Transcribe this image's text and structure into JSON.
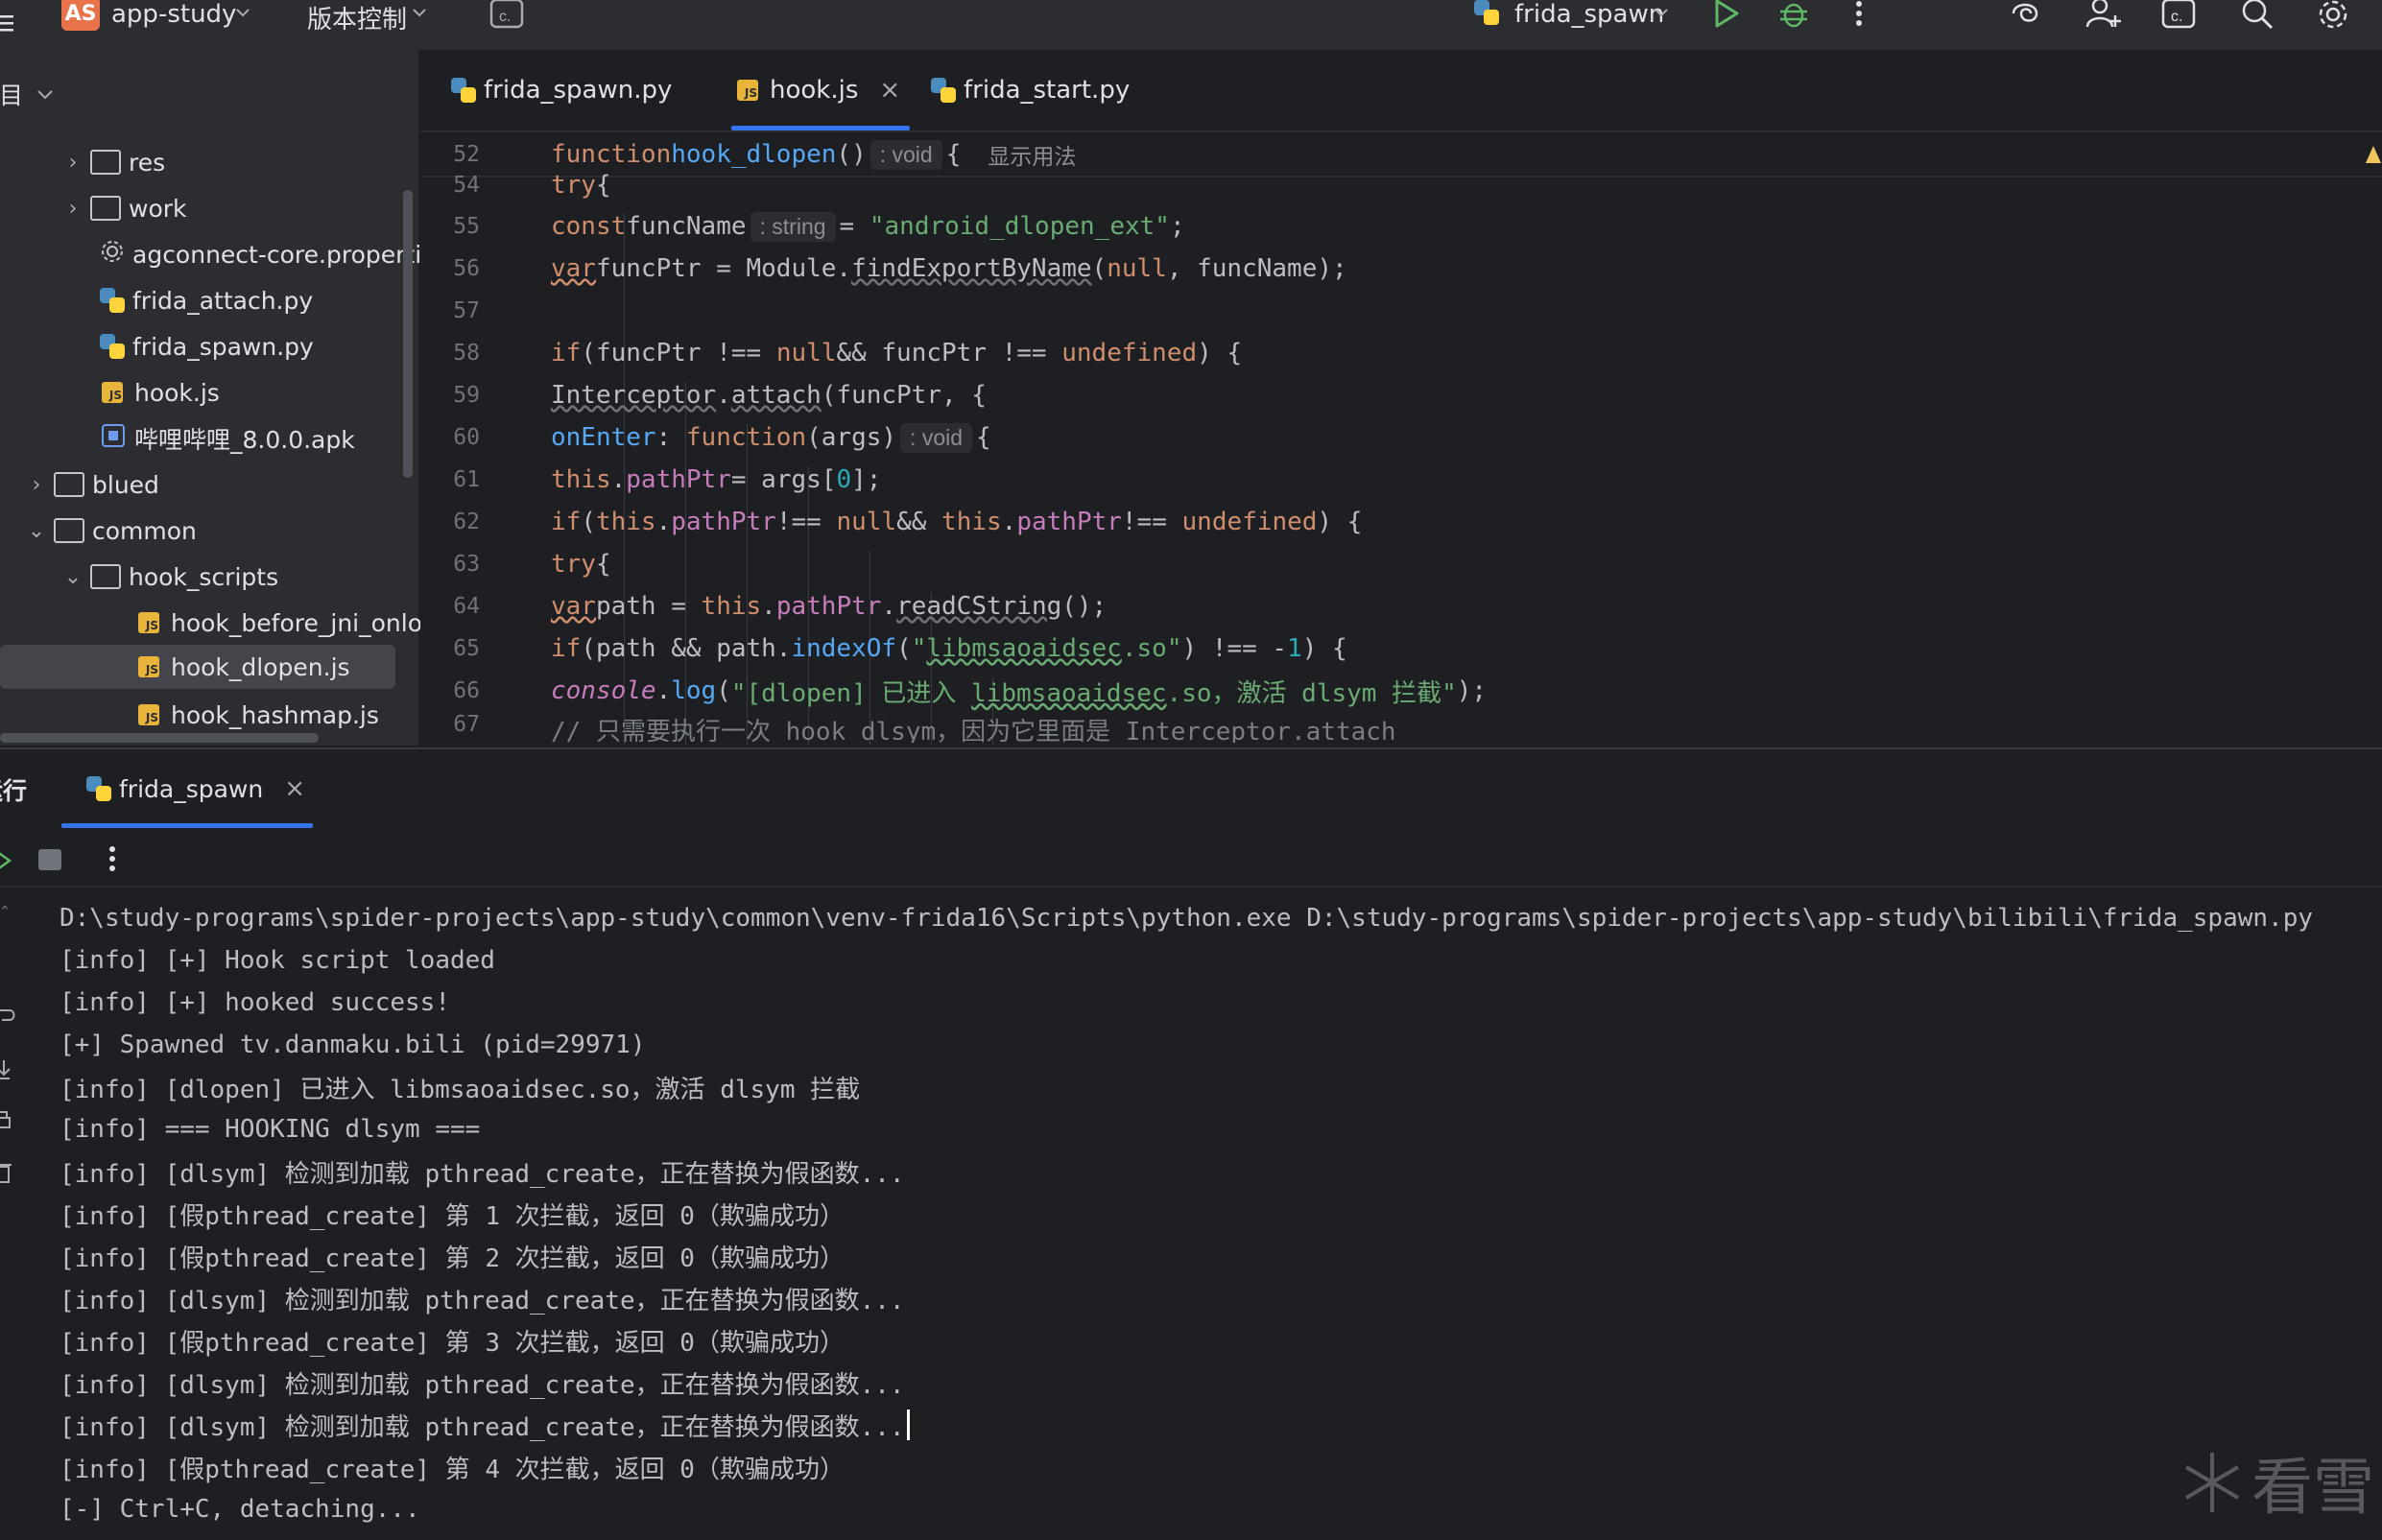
{
  "topbar": {
    "menu_icon": "hamburger-icon",
    "project_badge": "AS",
    "project_name": "app-study",
    "vcs_label": "版本控制",
    "run_config": "frida_spawn"
  },
  "project_panel": {
    "title": "项目",
    "items": [
      {
        "label": "res",
        "type": "folder"
      },
      {
        "label": "work",
        "type": "folder"
      },
      {
        "label": "agconnect-core.properties",
        "type": "properties"
      },
      {
        "label": "frida_attach.py",
        "type": "python"
      },
      {
        "label": "frida_spawn.py",
        "type": "python"
      },
      {
        "label": "hook.js",
        "type": "js"
      },
      {
        "label": "哔哩哔哩_8.0.0.apk",
        "type": "apk"
      },
      {
        "label": "blued",
        "type": "folder"
      },
      {
        "label": "common",
        "type": "folder"
      },
      {
        "label": "hook_scripts",
        "type": "folder"
      },
      {
        "label": "hook_before_jni_onloa",
        "type": "js"
      },
      {
        "label": "hook_dlopen.js",
        "type": "js"
      },
      {
        "label": "hook_hashmap.js",
        "type": "js"
      }
    ]
  },
  "editor": {
    "tabs": [
      {
        "label": "frida_spawn.py"
      },
      {
        "label": "hook.js"
      },
      {
        "label": "frida_start.py"
      }
    ],
    "sticky": {
      "line": "52",
      "func_kw": "function",
      "func_name": "hook_dlopen",
      "paren": "()",
      "hint": ": void",
      "brace": "{",
      "usage": "显示用法"
    },
    "line_numbers": [
      "54",
      "55",
      "56",
      "57",
      "58",
      "59",
      "60",
      "61",
      "62",
      "63",
      "64",
      "65",
      "66",
      "67"
    ]
  },
  "run_panel": {
    "title": "运行",
    "tab_label": "frida_spawn",
    "console": [
      "D:\\study-programs\\spider-projects\\app-study\\common\\venv-frida16\\Scripts\\python.exe D:\\study-programs\\spider-projects\\app-study\\bilibili\\frida_spawn.py",
      "[info] [+] Hook script loaded",
      "[info] [+] hooked success!",
      "[+] Spawned tv.danmaku.bili (pid=29971)",
      "[info] [dlopen] 已进入 libmsaoaidsec.so，激活 dlsym 拦截",
      "[info] === HOOKING dlsym ===",
      "[info] [dlsym] 检测到加载 pthread_create，正在替换为假函数...",
      "[info] [假pthread_create] 第 1 次拦截，返回 0（欺骗成功）",
      "[info] [假pthread_create] 第 2 次拦截，返回 0（欺骗成功）",
      "[info] [dlsym] 检测到加载 pthread_create，正在替换为假函数...",
      "[info] [假pthread_create] 第 3 次拦截，返回 0（欺骗成功）",
      "[info] [dlsym] 检测到加载 pthread_create，正在替换为假函数...",
      "[info] [dlsym] 检测到加载 pthread_create，正在替换为假函数...",
      "[info] [假pthread_create] 第 4 次拦截，返回 0（欺骗成功）",
      "[-] Ctrl+C, detaching..."
    ],
    "watermark": "看雪"
  },
  "colors": {
    "accent": "#3574f0",
    "keyword": "#cf8e6d",
    "string": "#6aab73",
    "function": "#56a8f5",
    "property": "#c77dbb"
  }
}
